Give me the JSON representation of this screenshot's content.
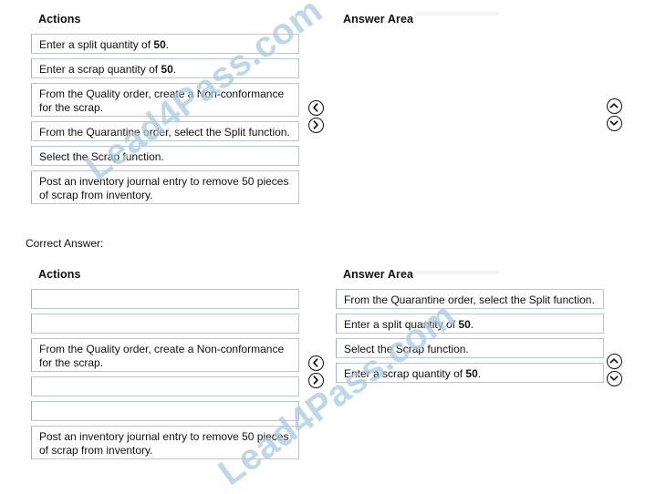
{
  "watermark": {
    "text": "Lead4Pass.com",
    "color": "#aacbe2"
  },
  "question_section": {
    "actions": {
      "heading": "Actions",
      "items": [
        {
          "text_before": "Enter a split quantity of ",
          "bold": "50",
          "text_after": ".",
          "lines": 1
        },
        {
          "text_before": "Enter a scrap quantity of ",
          "bold": "50",
          "text_after": ".",
          "lines": 1
        },
        {
          "text_before": "From the Quality order, create a Non-conformance for the scrap.",
          "bold": "",
          "text_after": "",
          "lines": 2
        },
        {
          "text_before": "From the Quarantine order, select the Split function.",
          "bold": "",
          "text_after": "",
          "lines": 1
        },
        {
          "text_before": "Select the Scrap function.",
          "bold": "",
          "text_after": "",
          "lines": 1
        },
        {
          "text_before": "Post an inventory journal entry to remove 50 pieces of scrap from inventory.",
          "bold": "",
          "text_after": "",
          "lines": 2
        }
      ]
    },
    "answer_area": {
      "heading": "Answer Area",
      "items": []
    },
    "move_buttons": {
      "left": "move-left-icon",
      "right": "move-right-icon",
      "up": "move-up-icon",
      "down": "move-down-icon"
    }
  },
  "correct_answer_label": "Correct Answer:",
  "answer_section": {
    "actions": {
      "heading": "Actions",
      "items": [
        {
          "text_before": "",
          "bold": "",
          "text_after": "",
          "lines": 1
        },
        {
          "text_before": "",
          "bold": "",
          "text_after": "",
          "lines": 1
        },
        {
          "text_before": "From the Quality order, create a Non-conformance for the scrap.",
          "bold": "",
          "text_after": "",
          "lines": 2
        },
        {
          "text_before": "",
          "bold": "",
          "text_after": "",
          "lines": 1
        },
        {
          "text_before": "",
          "bold": "",
          "text_after": "",
          "lines": 1
        },
        {
          "text_before": "Post an inventory journal entry to remove 50 pieces of scrap from inventory.",
          "bold": "",
          "text_after": "",
          "lines": 2
        }
      ]
    },
    "answer_area": {
      "heading": "Answer Area",
      "items": [
        {
          "text_before": "From the Quarantine order, select the Split function.",
          "bold": "",
          "text_after": "",
          "lines": 1
        },
        {
          "text_before": "Enter a split quantity of ",
          "bold": "50",
          "text_after": ".",
          "lines": 1
        },
        {
          "text_before": "Select the Scrap function.",
          "bold": "",
          "text_after": "",
          "lines": 1
        },
        {
          "text_before": "Enter a scrap quantity of ",
          "bold": "50",
          "text_after": ".",
          "lines": 1
        }
      ]
    },
    "move_buttons": {
      "left": "move-left-icon",
      "right": "move-right-icon",
      "up": "move-up-icon",
      "down": "move-down-icon"
    }
  }
}
